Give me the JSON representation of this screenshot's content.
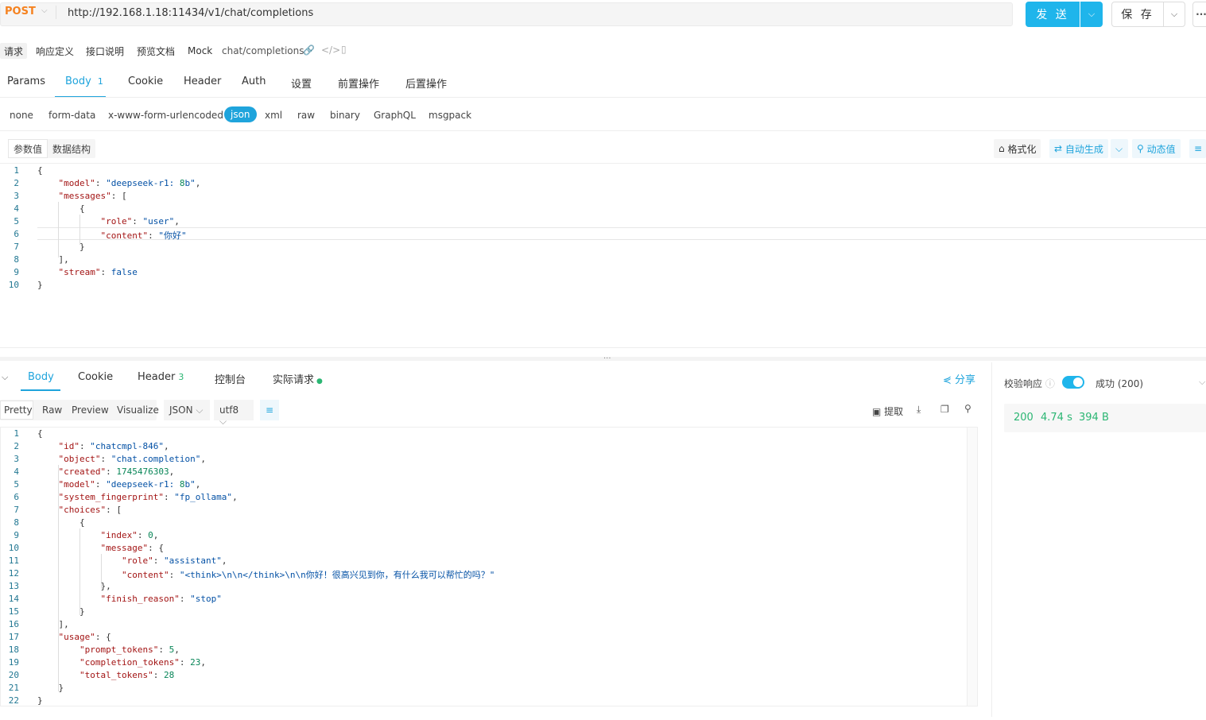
{
  "request": {
    "method": "POST",
    "url": "http://192.168.1.18:11434/v1/chat/completions",
    "send_label": "发 送",
    "save_label": "保 存",
    "more_label": "···"
  },
  "subtabs": [
    "请求",
    "响应定义",
    "接口说明",
    "预览文档",
    "Mock"
  ],
  "path": "chat/completions",
  "param_tabs": {
    "params": "Params",
    "body": "Body",
    "body_count": "1",
    "cookie": "Cookie",
    "header": "Header",
    "auth": "Auth",
    "settings": "设置",
    "pre": "前置操作",
    "post": "后置操作"
  },
  "body_types": [
    "none",
    "form-data",
    "x-www-form-urlencoded",
    "json",
    "xml",
    "raw",
    "binary",
    "GraphQL",
    "msgpack"
  ],
  "body_type_selected": "json",
  "value_tabs": [
    "参数值",
    "数据结构"
  ],
  "tools": {
    "format": "格式化",
    "autogen": "自动生成",
    "dynamic": "动态值"
  },
  "request_body_lines": [
    {
      "n": "1",
      "t": "{"
    },
    {
      "n": "2",
      "t": "    \"model\": \"deepseek-r1:8b\","
    },
    {
      "n": "3",
      "t": "    \"messages\": ["
    },
    {
      "n": "4",
      "t": "        {"
    },
    {
      "n": "5",
      "t": "            \"role\": \"user\","
    },
    {
      "n": "6",
      "t": "            \"content\": \"你好\""
    },
    {
      "n": "7",
      "t": "        }"
    },
    {
      "n": "8",
      "t": "    ],"
    },
    {
      "n": "9",
      "t": "    \"stream\": false"
    },
    {
      "n": "10",
      "t": "}"
    }
  ],
  "response_tabs": {
    "body": "Body",
    "cookie": "Cookie",
    "header": "Header",
    "header_count": "3",
    "console": "控制台",
    "actual": "实际请求",
    "share": "分享"
  },
  "response_formats": [
    "Pretty",
    "Raw",
    "Preview",
    "Visualize"
  ],
  "response_lang": "JSON",
  "response_encoding": "utf8",
  "response_tools": {
    "extract": "提取"
  },
  "response_lines": [
    {
      "n": "1",
      "t": "{"
    },
    {
      "n": "2",
      "t": "    \"id\": \"chatcmpl-846\","
    },
    {
      "n": "3",
      "t": "    \"object\": \"chat.completion\","
    },
    {
      "n": "4",
      "t": "    \"created\": 1745476303,"
    },
    {
      "n": "5",
      "t": "    \"model\": \"deepseek-r1:8b\","
    },
    {
      "n": "6",
      "t": "    \"system_fingerprint\": \"fp_ollama\","
    },
    {
      "n": "7",
      "t": "    \"choices\": ["
    },
    {
      "n": "8",
      "t": "        {"
    },
    {
      "n": "9",
      "t": "            \"index\": 0,"
    },
    {
      "n": "10",
      "t": "            \"message\": {"
    },
    {
      "n": "11",
      "t": "                \"role\": \"assistant\","
    },
    {
      "n": "12",
      "t": "                \"content\": \"<think>\\n\\n</think>\\n\\n你好！很高兴见到你，有什么我可以帮忙的吗？\""
    },
    {
      "n": "13",
      "t": "            },"
    },
    {
      "n": "14",
      "t": "            \"finish_reason\": \"stop\""
    },
    {
      "n": "15",
      "t": "        }"
    },
    {
      "n": "16",
      "t": "    ],"
    },
    {
      "n": "17",
      "t": "    \"usage\": {"
    },
    {
      "n": "18",
      "t": "        \"prompt_tokens\": 5,"
    },
    {
      "n": "19",
      "t": "        \"completion_tokens\": 23,"
    },
    {
      "n": "20",
      "t": "        \"total_tokens\": 28"
    },
    {
      "n": "21",
      "t": "    }"
    },
    {
      "n": "22",
      "t": "}"
    }
  ],
  "validation": {
    "label": "校验响应",
    "enabled": true,
    "result": "成功 (200)"
  },
  "status": {
    "code": "200",
    "time": "4.74 s",
    "size": "394 B",
    "color": "#2bb673"
  },
  "colors": {
    "accent": "#1fa4dc",
    "send": "#1fb5eb",
    "method": "#f5821f"
  }
}
